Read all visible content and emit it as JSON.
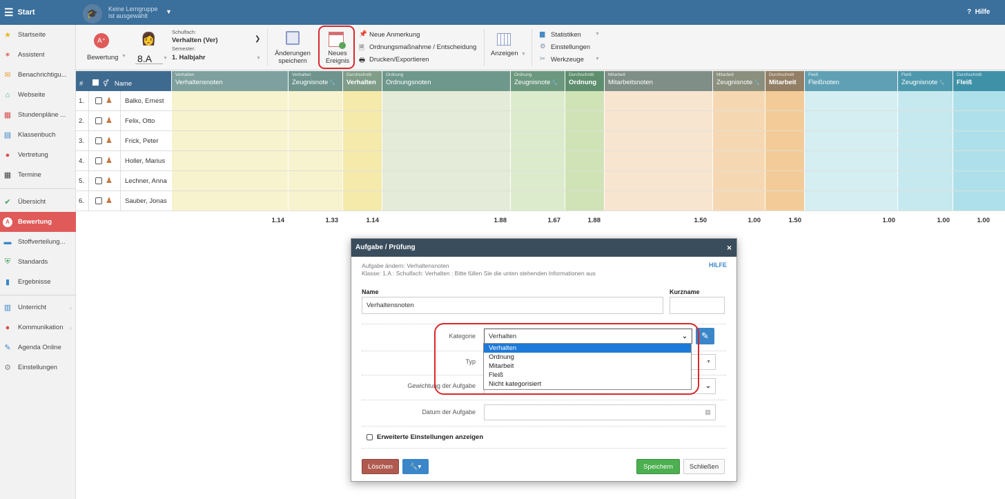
{
  "topbar": {
    "start_label": "Start",
    "group_line1": "Keine Lerngruppe",
    "group_line2": "ist ausgewählt",
    "help_label": "Hilfe"
  },
  "sidebar": {
    "items": [
      {
        "label": "Startseite",
        "icon": "star-icon"
      },
      {
        "label": "Assistent",
        "icon": "wand-icon"
      },
      {
        "label": "Benachrichtigu...",
        "icon": "envelope-icon"
      },
      {
        "label": "Webseite",
        "icon": "home-icon"
      },
      {
        "label": "Stundenpläne ...",
        "icon": "calendar-grid-icon"
      },
      {
        "label": "Klassenbuch",
        "icon": "book-icon"
      },
      {
        "label": "Vertretung",
        "icon": "person-icon"
      },
      {
        "label": "Termine",
        "icon": "calendar-icon"
      },
      {
        "label": "Übersicht",
        "icon": "check-circle-icon"
      },
      {
        "label": "Bewertung",
        "icon": "grade-icon"
      },
      {
        "label": "Stoffverteilung...",
        "icon": "briefcase-icon"
      },
      {
        "label": "Standards",
        "icon": "shield-icon"
      },
      {
        "label": "Ergebnisse",
        "icon": "bar-chart-icon"
      },
      {
        "label": "Unterricht",
        "icon": "open-book-icon"
      },
      {
        "label": "Kommunikation",
        "icon": "chat-icon"
      },
      {
        "label": "Agenda Online",
        "icon": "pen-icon"
      },
      {
        "label": "Einstellungen",
        "icon": "gear-icon"
      }
    ]
  },
  "toolbar": {
    "bewertung": "Bewertung",
    "class_name": "8.A",
    "schulfach_label": "Schulfach:",
    "schulfach_value": "Verhalten (Ver)",
    "semester_label": "Semester:",
    "semester_value": "1. Halbjahr",
    "save_changes": "Änderungen speichern",
    "new_event": "Neues Ereignis",
    "neue_anmerkung": "Neue Anmerkung",
    "ordnungsmassnahme": "Ordnungsmaßnahme / Entscheidung",
    "drucken": "Drucken/Exportieren",
    "anzeigen": "Anzeigen",
    "statistiken": "Statistiken",
    "einstellungen": "Einstellungen",
    "werkzeuge": "Werkzeuge"
  },
  "grid": {
    "col_num": "#",
    "col_name": "Name",
    "headers": [
      {
        "small": "Verhalten",
        "main": "Verhaltensnoten"
      },
      {
        "small": "Verhalten",
        "main": "Zeugnisnote"
      },
      {
        "small": "Durchschnitt",
        "main": "Verhalten"
      },
      {
        "small": "Ordnung",
        "main": "Ordnungsnoten"
      },
      {
        "small": "Ordnung",
        "main": "Zeugnisnote"
      },
      {
        "small": "Durchschnitt",
        "main": "Ordnung"
      },
      {
        "small": "Mitarbeit",
        "main": "Mitarbeitsnoten"
      },
      {
        "small": "Mitarbeit",
        "main": "Zeugnisnote"
      },
      {
        "small": "Durchschnitt",
        "main": "Mitarbeit"
      },
      {
        "small": "Fleiß",
        "main": "Fleißnoten"
      },
      {
        "small": "Fleiß",
        "main": "Zeugnisnote"
      },
      {
        "small": "Durchschnitt",
        "main": "Fleiß"
      }
    ],
    "students": [
      {
        "num": "1.",
        "name": "Balko, Ernest"
      },
      {
        "num": "2.",
        "name": "Felix, Otto"
      },
      {
        "num": "3.",
        "name": "Frick, Peter"
      },
      {
        "num": "4.",
        "name": "Holler, Marius"
      },
      {
        "num": "5.",
        "name": "Lechner, Anna"
      },
      {
        "num": "6.",
        "name": "Sauber, Jonas"
      }
    ],
    "averages": [
      "1.14",
      "1.33",
      "1.14",
      "1.88",
      "1.67",
      "1.88",
      "1.50",
      "1.00",
      "1.50",
      "1.00",
      "1.00",
      "1.00"
    ]
  },
  "dialog": {
    "title": "Aufgabe / Prüfung",
    "close": "×",
    "subtitle1": "Aufgabe ändern: Verhaltensnoten",
    "subtitle2": "Klasse: 1.A : Schulfach: Verhalten : Bitte füllen Sie die unten stehenden Informationen aus",
    "help": "HILFE",
    "name_label": "Name",
    "name_value": "Verhaltensnoten",
    "kurzname_label": "Kurzname",
    "kurzname_value": "",
    "kategorie_label": "Kategorie",
    "kategorie_value": "Verhalten",
    "typ_label": "Typ",
    "gewichtung_label": "Gewichtung der Aufgabe",
    "datum_label": "Datum der Aufgabe",
    "erweiterte": "Erweiterte Einstellungen anzeigen",
    "loeschen": "Löschen",
    "speichern": "Speichern",
    "schliessen": "Schließen",
    "kategorie_options": [
      "Verhalten",
      "Ordnung",
      "Mitarbeit",
      "Fleiß",
      "Nicht kategorisiert"
    ]
  },
  "colors": {
    "accent": "#3b6f9c",
    "active": "#e05a5a",
    "highlight": "#d9262c"
  }
}
